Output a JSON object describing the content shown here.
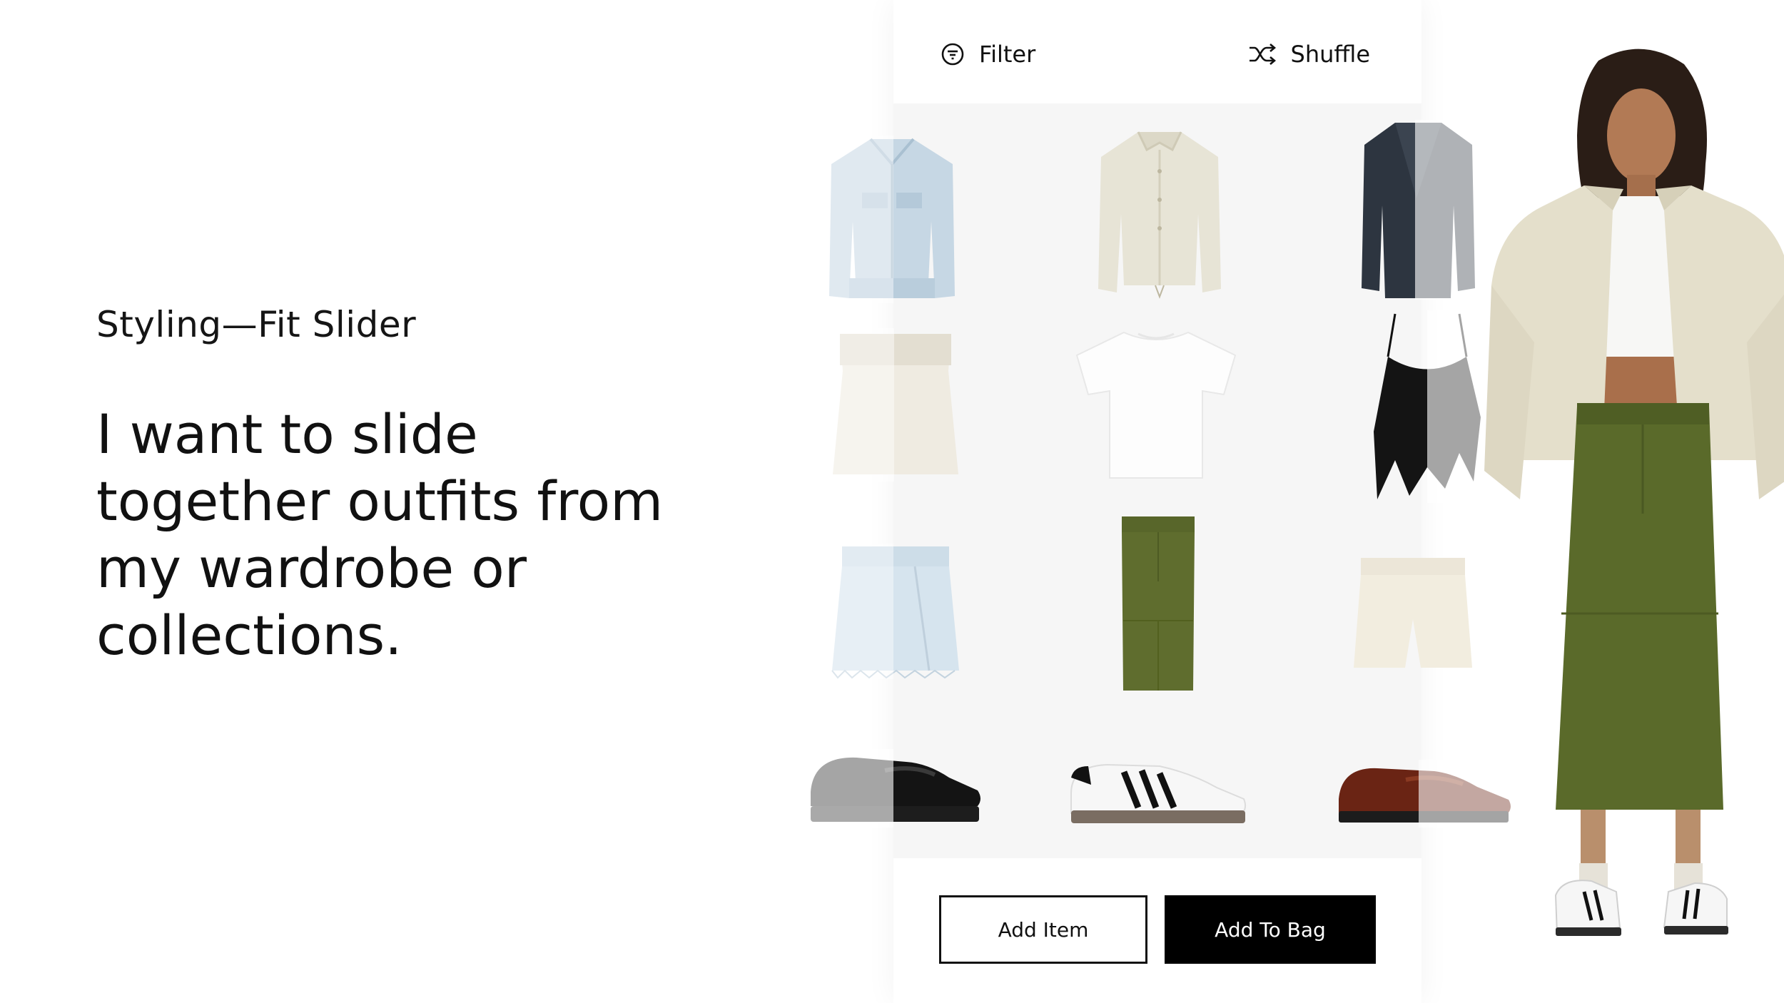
{
  "intro": {
    "eyebrow": "Styling—Fit Slider",
    "headline_lines": [
      "I want to slide",
      "together outfits from",
      "my wardrobe or",
      "collections."
    ]
  },
  "toolbar": {
    "filter_label": "Filter",
    "shuffle_label": "Shuffle",
    "filter_icon": "filter-icon",
    "shuffle_icon": "shuffle-icon"
  },
  "rows": [
    {
      "row": "outerwear",
      "items": [
        "denim-jacket",
        "ivory-coach-jacket",
        "navy-blazer"
      ]
    },
    {
      "row": "tops",
      "items": [
        "ivory-tube-top",
        "white-crop-tee",
        "black-ruffle-cami"
      ]
    },
    {
      "row": "bottoms",
      "items": [
        "light-denim-mini-skirt",
        "olive-midi-skirt",
        "cream-shorts"
      ]
    },
    {
      "row": "shoes",
      "items": [
        "black-loafer",
        "white-black-stripe-sneaker",
        "brown-penny-loafer"
      ]
    }
  ],
  "actions": {
    "add_item_label": "Add Item",
    "add_to_bag_label": "Add To Bag"
  },
  "colors": {
    "background": "#ffffff",
    "panel_grid": "#f6f6f6",
    "primary_button": "#000000",
    "olive": "#5e6b2b",
    "ivory": "#e7e3d2"
  }
}
